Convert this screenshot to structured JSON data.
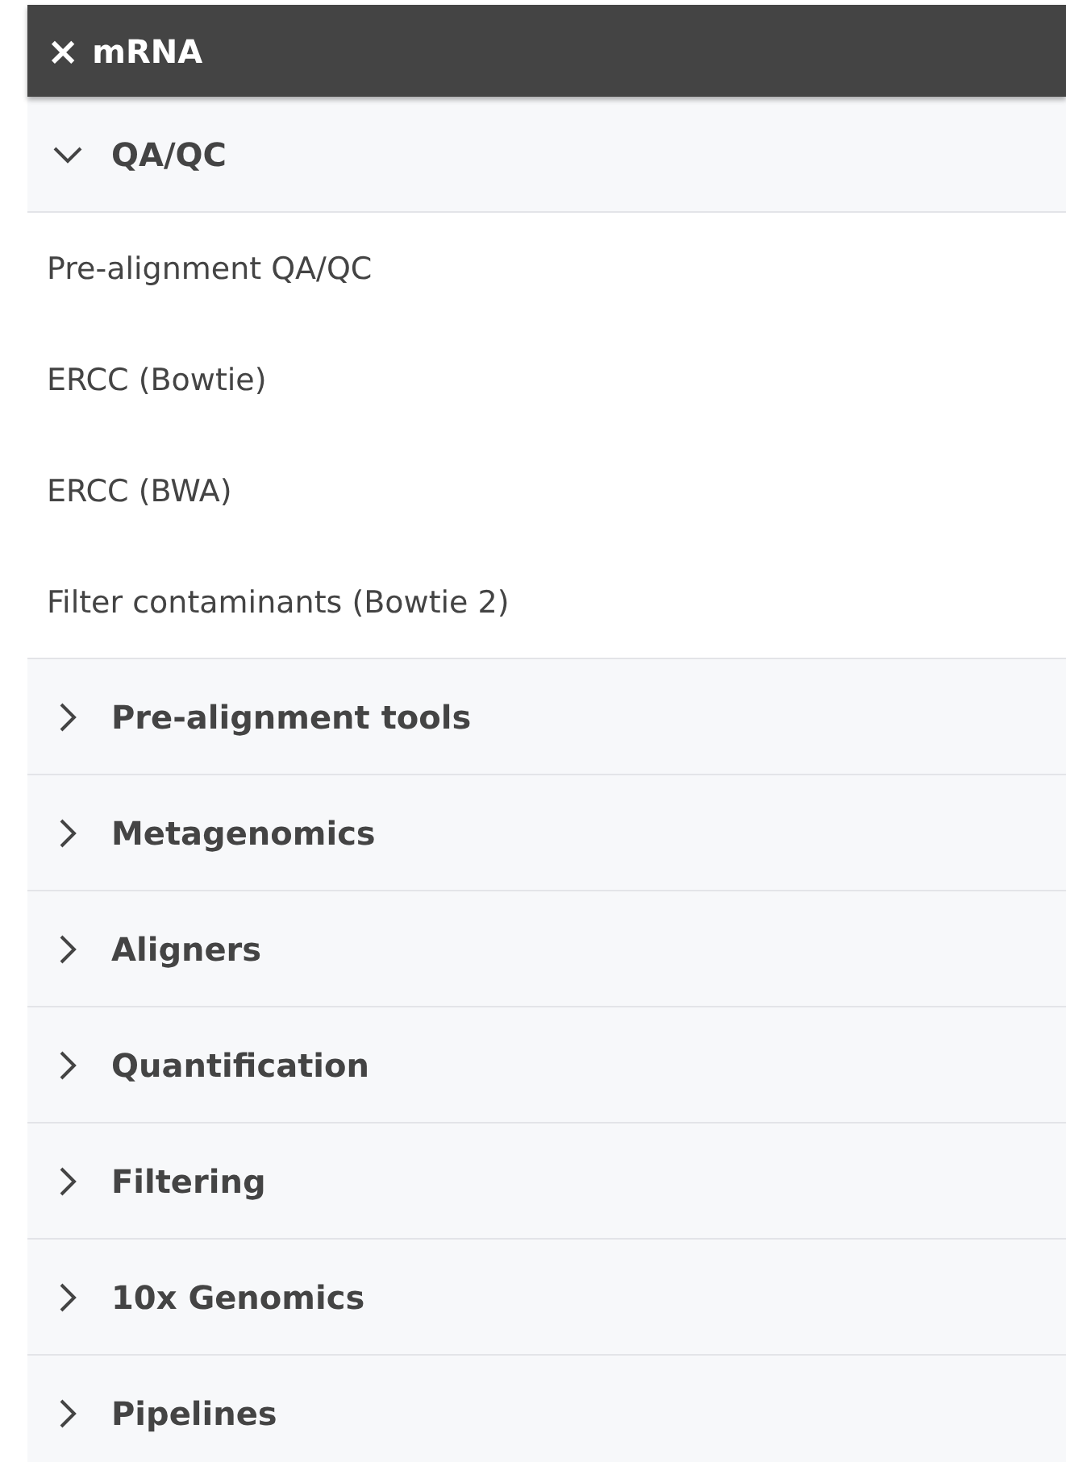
{
  "panel": {
    "title": "mRNA",
    "close_icon": "×"
  },
  "sections": [
    {
      "label": "QA/QC",
      "expanded": true,
      "items": [
        "Pre-alignment QA/QC",
        "ERCC (Bowtie)",
        "ERCC (BWA)",
        "Filter contaminants (Bowtie 2)"
      ]
    },
    {
      "label": "Pre-alignment tools",
      "expanded": false
    },
    {
      "label": "Metagenomics",
      "expanded": false
    },
    {
      "label": "Aligners",
      "expanded": false
    },
    {
      "label": "Quantification",
      "expanded": false
    },
    {
      "label": "Filtering",
      "expanded": false
    },
    {
      "label": "10x Genomics",
      "expanded": false
    },
    {
      "label": "Pipelines",
      "expanded": false
    }
  ]
}
